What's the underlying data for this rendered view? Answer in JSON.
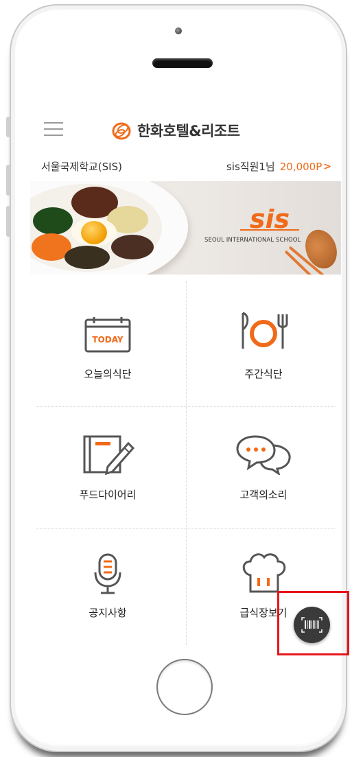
{
  "header": {
    "brand_name": "한화호텔&리조트",
    "menu_icon": "hamburger-menu-icon",
    "logo_icon": "hanwha-logo-icon"
  },
  "user_bar": {
    "school_name": "서울국제학교(SIS)",
    "user_name": "sis직원1님",
    "points": "20,000P",
    "chevron": ">"
  },
  "banner": {
    "logo_text": "sis",
    "caption": "SEOUL INTERNATIONAL SCHOOL"
  },
  "menu": {
    "items": [
      {
        "label": "오늘의식단",
        "icon": "calendar-today-icon",
        "icon_text": "TODAY"
      },
      {
        "label": "주간식단",
        "icon": "fork-plate-knife-icon"
      },
      {
        "label": "푸드다이어리",
        "icon": "notebook-pen-icon"
      },
      {
        "label": "고객의소리",
        "icon": "chat-bubbles-icon"
      },
      {
        "label": "공지사항",
        "icon": "microphone-icon"
      },
      {
        "label": "급식장보기",
        "icon": "chef-hat-icon"
      }
    ]
  },
  "floating": {
    "icon": "barcode-scan-icon"
  },
  "colors": {
    "accent": "#f06a19",
    "icon_gray": "#555555",
    "highlight": "#e8141c"
  }
}
